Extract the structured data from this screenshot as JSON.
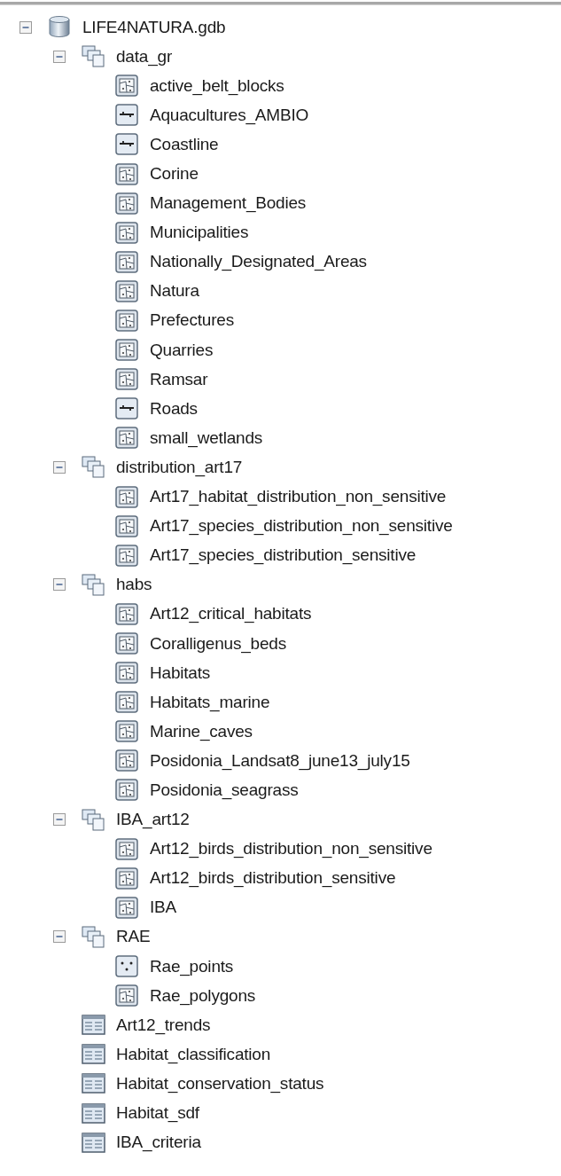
{
  "tree": {
    "label": "LIFE4NATURA.gdb",
    "kind": "geodatabase",
    "expanded": true,
    "children": [
      {
        "label": "data_gr",
        "kind": "dataset",
        "expanded": true,
        "children": [
          {
            "label": "active_belt_blocks",
            "kind": "polygon"
          },
          {
            "label": "Aquacultures_AMBIO",
            "kind": "line"
          },
          {
            "label": "Coastline",
            "kind": "line"
          },
          {
            "label": "Corine",
            "kind": "polygon"
          },
          {
            "label": "Management_Bodies",
            "kind": "polygon"
          },
          {
            "label": "Municipalities",
            "kind": "polygon"
          },
          {
            "label": "Nationally_Designated_Areas",
            "kind": "polygon"
          },
          {
            "label": "Natura",
            "kind": "polygon"
          },
          {
            "label": "Prefectures",
            "kind": "polygon"
          },
          {
            "label": "Quarries",
            "kind": "polygon"
          },
          {
            "label": "Ramsar",
            "kind": "polygon"
          },
          {
            "label": "Roads",
            "kind": "line"
          },
          {
            "label": "small_wetlands",
            "kind": "polygon"
          }
        ]
      },
      {
        "label": "distribution_art17",
        "kind": "dataset",
        "expanded": true,
        "children": [
          {
            "label": "Art17_habitat_distribution_non_sensitive",
            "kind": "polygon"
          },
          {
            "label": "Art17_species_distribution_non_sensitive",
            "kind": "polygon"
          },
          {
            "label": "Art17_species_distribution_sensitive",
            "kind": "polygon"
          }
        ]
      },
      {
        "label": "habs",
        "kind": "dataset",
        "expanded": true,
        "children": [
          {
            "label": "Art12_critical_habitats",
            "kind": "polygon"
          },
          {
            "label": "Coralligenus_beds",
            "kind": "polygon"
          },
          {
            "label": "Habitats",
            "kind": "polygon"
          },
          {
            "label": "Habitats_marine",
            "kind": "polygon"
          },
          {
            "label": "Marine_caves",
            "kind": "polygon"
          },
          {
            "label": "Posidonia_Landsat8_june13_july15",
            "kind": "polygon"
          },
          {
            "label": "Posidonia_seagrass",
            "kind": "polygon"
          }
        ]
      },
      {
        "label": "IBA_art12",
        "kind": "dataset",
        "expanded": true,
        "children": [
          {
            "label": "Art12_birds_distribution_non_sensitive",
            "kind": "polygon"
          },
          {
            "label": "Art12_birds_distribution_sensitive",
            "kind": "polygon"
          },
          {
            "label": "IBA",
            "kind": "polygon"
          }
        ]
      },
      {
        "label": "RAE",
        "kind": "dataset",
        "expanded": true,
        "children": [
          {
            "label": "Rae_points",
            "kind": "point"
          },
          {
            "label": "Rae_polygons",
            "kind": "polygon"
          }
        ]
      },
      {
        "label": "Art12_trends",
        "kind": "table"
      },
      {
        "label": "Habitat_classification",
        "kind": "table"
      },
      {
        "label": "Habitat_conservation_status",
        "kind": "table"
      },
      {
        "label": "Habitat_sdf",
        "kind": "table"
      },
      {
        "label": "IBA_criteria",
        "kind": "table"
      }
    ]
  }
}
